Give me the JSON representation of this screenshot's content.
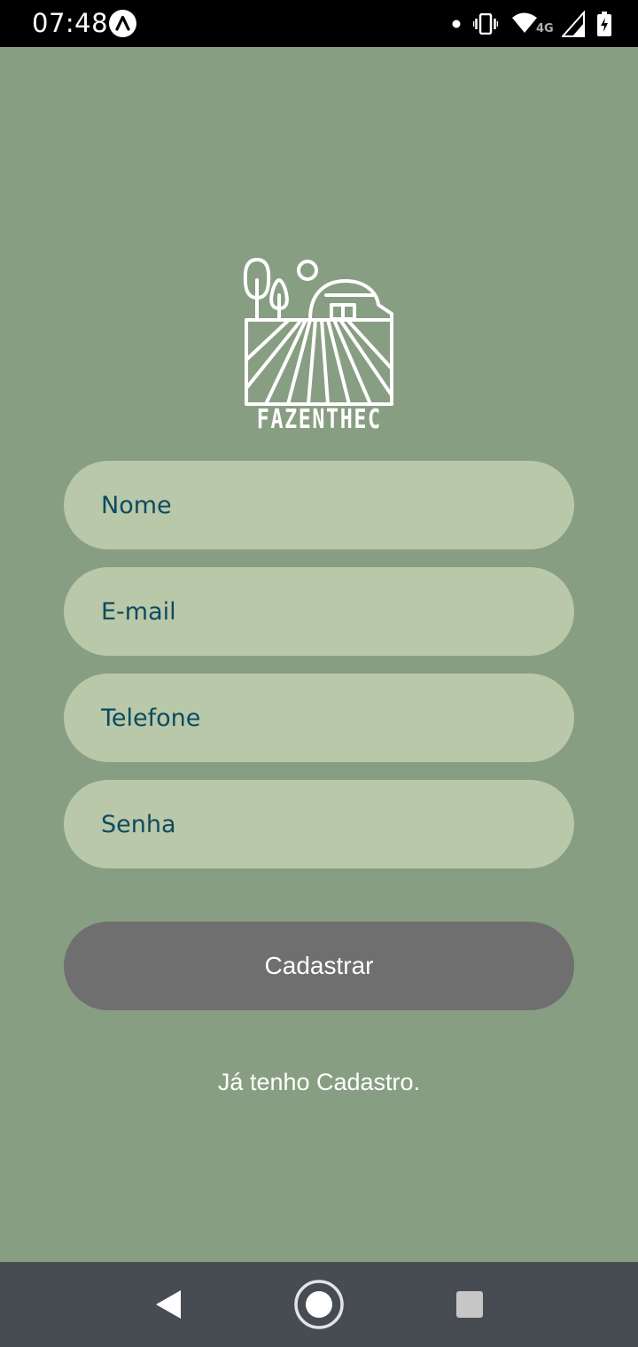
{
  "status_bar": {
    "time": "07:48",
    "network_label": "4G",
    "icons": [
      "automation-app-icon",
      "notification-dot-icon",
      "vibrate-icon",
      "wifi-icon",
      "signal-icon",
      "battery-charging-icon"
    ]
  },
  "logo": {
    "name": "FAZENTHEC",
    "icon": "farm-field-barn-logo"
  },
  "form": {
    "nome_placeholder": "Nome",
    "email_placeholder": "E-mail",
    "telefone_placeholder": "Telefone",
    "senha_placeholder": "Senha",
    "submit_label": "Cadastrar",
    "login_link": "Já tenho Cadastro."
  },
  "nav_bar": {
    "icons": [
      "back-icon",
      "home-icon",
      "recents-icon"
    ]
  },
  "colors": {
    "background": "#889e82",
    "field_background": "#b9c8a9",
    "field_text": "#0d4a5f",
    "button_background": "#6f6f6f",
    "status_bar": "#000000",
    "nav_bar": "#464c52"
  }
}
